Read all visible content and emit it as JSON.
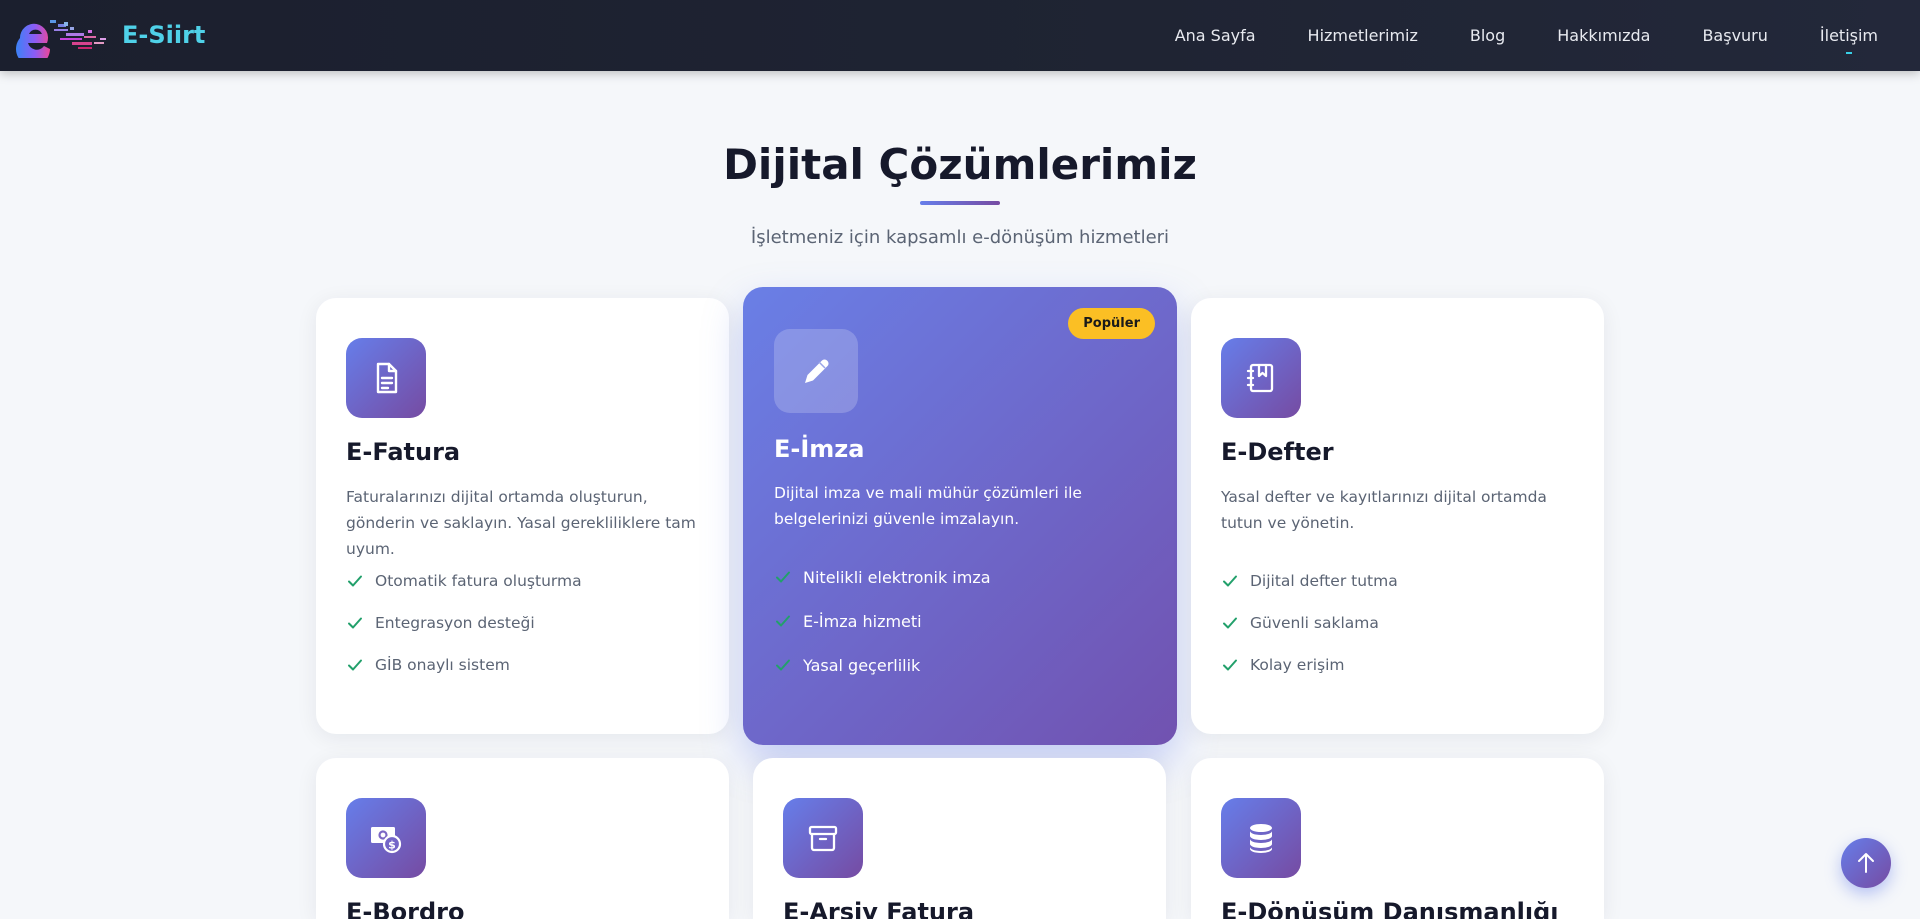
{
  "brand": {
    "name": "E-Siirt"
  },
  "nav": {
    "items": [
      "Ana Sayfa",
      "Hizmetlerimiz",
      "Blog",
      "Hakkımızda",
      "Başvuru",
      "İletişim"
    ],
    "active": "İletişim"
  },
  "section": {
    "title": "Dijital Çözümlerimiz",
    "subtitle": "İşletmeniz için kapsamlı e-dönüşüm hizmetleri"
  },
  "cards": [
    {
      "icon": "document-icon",
      "title": "E-Fatura",
      "description": "Faturalarınızı dijital ortamda oluşturun, gönderin ve saklayın. Yasal gerekliliklere tam uyum.",
      "features": [
        "Otomatik fatura oluşturma",
        "Entegrasyon desteği",
        "GİB onaylı sistem"
      ]
    },
    {
      "icon": "pen-icon",
      "title": "E-İmza",
      "badge": "Popüler",
      "description": "Dijital imza ve mali mühür çözümleri ile belgelerinizi güvenle imzalayın.",
      "features": [
        "Nitelikli elektronik imza",
        "E-İmza hizmeti",
        "Yasal geçerlilik"
      ]
    },
    {
      "icon": "notebook-icon",
      "title": "E-Defter",
      "description": "Yasal defter ve kayıtlarınızı dijital ortamda tutun ve yönetin.",
      "features": [
        "Dijital defter tutma",
        "Güvenli saklama",
        "Kolay erişim"
      ]
    },
    {
      "icon": "money-icon",
      "title": "E-Bordro"
    },
    {
      "icon": "archive-box-icon",
      "title": "E-Arşiv Fatura"
    },
    {
      "icon": "database-icon",
      "title": "E-Dönüşüm Danışmanlığı"
    }
  ],
  "colors": {
    "navbar": "#1b1f2e",
    "brand": "#4fd1e8",
    "gradient_start": "#667eea",
    "gradient_end": "#764ba2",
    "badge": "#fbbf24",
    "check": "#22a06b"
  }
}
